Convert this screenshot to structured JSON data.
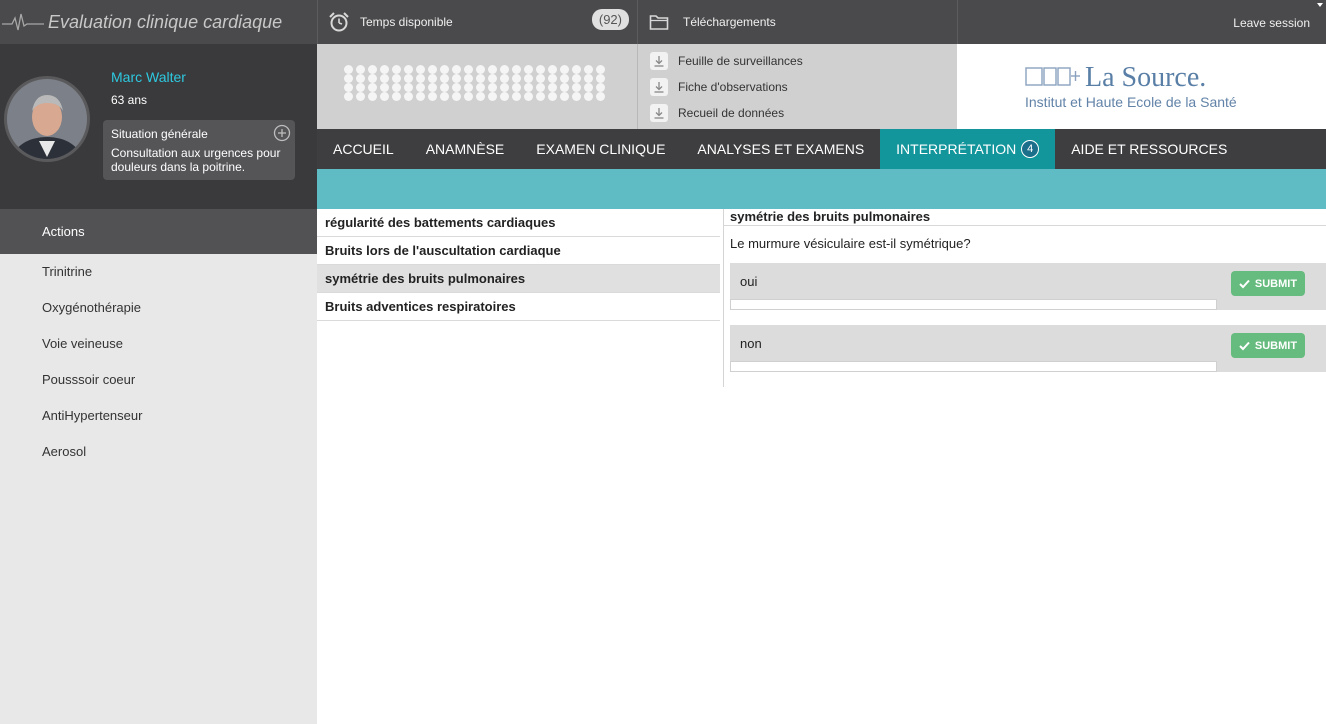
{
  "app": {
    "title": "Evaluation clinique cardiaque"
  },
  "header": {
    "timer_label": "Temps disponible",
    "timer_count": "(92)",
    "downloads_label": "Téléchargements",
    "leave_label": "Leave session"
  },
  "patient": {
    "name": "Marc Walter",
    "age": "63 ans",
    "situation_title": "Situation générale",
    "situation_text": "Consultation aux urgences pour douleurs dans la poitrine."
  },
  "downloads": [
    {
      "label": "Feuille de surveillances"
    },
    {
      "label": "Fiche d'observations"
    },
    {
      "label": "Recueil de données"
    }
  ],
  "logo": {
    "title": "La Source.",
    "subtitle": "Institut et Haute Ecole de la Santé"
  },
  "nav": {
    "items": [
      {
        "label": "ACCUEIL"
      },
      {
        "label": "ANAMNÈSE"
      },
      {
        "label": "EXAMEN CLINIQUE"
      },
      {
        "label": "ANALYSES ET EXAMENS"
      },
      {
        "label": "INTERPRÉTATION",
        "badge": "4"
      },
      {
        "label": "AIDE ET RESSOURCES"
      }
    ],
    "active_index": 4
  },
  "sidebar": {
    "header": "Actions",
    "items": [
      {
        "label": "Trinitrine"
      },
      {
        "label": "Oxygénothérapie"
      },
      {
        "label": "Voie veineuse"
      },
      {
        "label": "Pousssoir coeur"
      },
      {
        "label": "AntiHypertenseur"
      },
      {
        "label": "Aerosol"
      }
    ]
  },
  "questions": [
    {
      "label": "régularité des battements cardiaques"
    },
    {
      "label": "Bruits lors de l'auscultation cardiaque"
    },
    {
      "label": "symétrie des bruits pulmonaires"
    },
    {
      "label": "Bruits adventices respiratoires"
    }
  ],
  "selected_question_index": 2,
  "detail": {
    "title": "symétrie des bruits pulmonaires",
    "question": "Le murmure vésiculaire est-il symétrique?",
    "answers": [
      {
        "label": "oui",
        "submit_label": "SUBMIT"
      },
      {
        "label": "non",
        "submit_label": "SUBMIT"
      }
    ]
  },
  "colors": {
    "accent_teal": "#13959c",
    "band_teal": "#5fbcc4",
    "patient_name": "#2ec9e0",
    "submit_green": "#66bb7e"
  },
  "icons": [
    "heartbeat-icon",
    "alarm-clock-icon",
    "folder-icon",
    "plus-circle-icon",
    "download-icon",
    "check-icon"
  ]
}
